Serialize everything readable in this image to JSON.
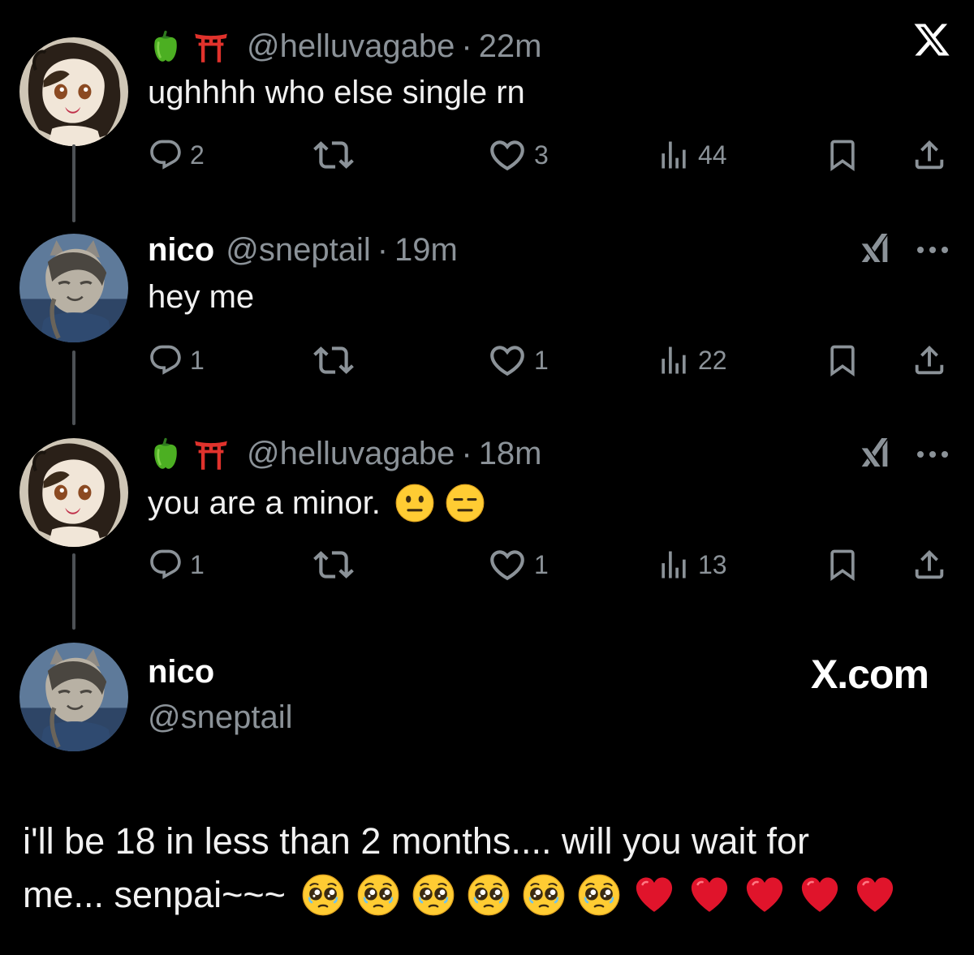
{
  "colors": {
    "background": "#000000",
    "text": "#e7e9ea",
    "muted": "#8b9298",
    "heart_red": "#e0142b"
  },
  "close_icon": "x-logo-icon",
  "tweets": [
    {
      "name_emojis": [
        "bell-pepper-emoji",
        "torii-gate-emoji"
      ],
      "display_name": "",
      "handle": "@helluvagabe",
      "sep": "·",
      "time": "22m",
      "text": "ughhhh who else single rn",
      "replies": "2",
      "retweets": "",
      "likes": "3",
      "views": "44"
    },
    {
      "name_emojis": [],
      "display_name": "nico",
      "handle": "@sneptail",
      "sep": "·",
      "time": "19m",
      "text": "hey me",
      "replies": "1",
      "retweets": "",
      "likes": "1",
      "views": "22"
    },
    {
      "name_emojis": [
        "bell-pepper-emoji",
        "torii-gate-emoji"
      ],
      "display_name": "",
      "handle": "@helluvagabe",
      "sep": "·",
      "time": "18m",
      "text": "you are a minor.",
      "text_emojis": [
        "neutral-face-emoji",
        "expressionless-face-emoji"
      ],
      "replies": "1",
      "retweets": "",
      "likes": "1",
      "views": "13"
    }
  ],
  "quoted": {
    "display_name": "nico",
    "handle": "@sneptail",
    "brand": "X.com",
    "text_line1": "i'll be 18 in less than 2 months.... will you wait for",
    "text_line2": "me... senpai~~~",
    "emojis": [
      "pleading-face-emoji",
      "pleading-face-emoji",
      "pleading-face-emoji",
      "pleading-face-emoji",
      "pleading-face-emoji",
      "pleading-face-emoji",
      "red-heart-emoji",
      "red-heart-emoji",
      "red-heart-emoji",
      "red-heart-emoji",
      "red-heart-emoji"
    ]
  }
}
